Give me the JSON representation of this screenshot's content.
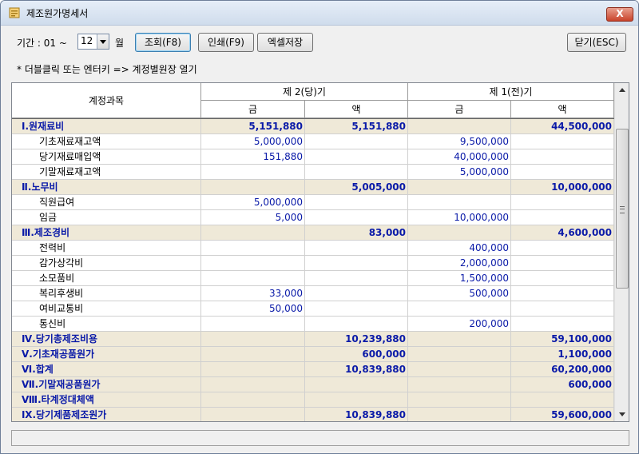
{
  "window": {
    "title": "제조원가명세서",
    "close_label": "X"
  },
  "toolbar": {
    "period_label": "기간 : 01 ~",
    "month_value": "12",
    "month_suffix": "월",
    "query_button": "조회(F8)",
    "print_button": "인쇄(F9)",
    "excel_button": "엑셀저장",
    "close_button": "닫기(ESC)"
  },
  "hint": "* 더블클릭 또는 엔터키 => 계정별원장 열기",
  "table": {
    "header_account": "계정과목",
    "period2": "제 2(당)기",
    "period1": "제 1(전)기",
    "amount_label": "금",
    "amount_label2": "액",
    "rows": [
      {
        "level": 0,
        "name": "Ⅰ.원재료비",
        "c1": "5,151,880",
        "c2": "5,151,880",
        "c3": "",
        "c4": "44,500,000"
      },
      {
        "level": 1,
        "name": "기초재료재고액",
        "c1": "5,000,000",
        "c2": "",
        "c3": "9,500,000",
        "c4": ""
      },
      {
        "level": 1,
        "name": "당기재료매입액",
        "c1": "151,880",
        "c2": "",
        "c3": "40,000,000",
        "c4": ""
      },
      {
        "level": 1,
        "name": "기말재료재고액",
        "c1": "",
        "c2": "",
        "c3": "5,000,000",
        "c4": ""
      },
      {
        "level": 0,
        "name": "Ⅱ.노무비",
        "c1": "",
        "c2": "5,005,000",
        "c3": "",
        "c4": "10,000,000"
      },
      {
        "level": 1,
        "name": "직원급여",
        "c1": "5,000,000",
        "c2": "",
        "c3": "",
        "c4": ""
      },
      {
        "level": 1,
        "name": "임금",
        "c1": "5,000",
        "c2": "",
        "c3": "10,000,000",
        "c4": ""
      },
      {
        "level": 0,
        "name": "Ⅲ.제조경비",
        "c1": "",
        "c2": "83,000",
        "c3": "",
        "c4": "4,600,000"
      },
      {
        "level": 1,
        "name": "전력비",
        "c1": "",
        "c2": "",
        "c3": "400,000",
        "c4": ""
      },
      {
        "level": 1,
        "name": "감가상각비",
        "c1": "",
        "c2": "",
        "c3": "2,000,000",
        "c4": ""
      },
      {
        "level": 1,
        "name": "소모품비",
        "c1": "",
        "c2": "",
        "c3": "1,500,000",
        "c4": ""
      },
      {
        "level": 1,
        "name": "복리후생비",
        "c1": "33,000",
        "c2": "",
        "c3": "500,000",
        "c4": ""
      },
      {
        "level": 1,
        "name": "여비교통비",
        "c1": "50,000",
        "c2": "",
        "c3": "",
        "c4": ""
      },
      {
        "level": 1,
        "name": "통신비",
        "c1": "",
        "c2": "",
        "c3": "200,000",
        "c4": ""
      },
      {
        "level": 0,
        "name": "Ⅳ.당기총제조비용",
        "c1": "",
        "c2": "10,239,880",
        "c3": "",
        "c4": "59,100,000"
      },
      {
        "level": 0,
        "name": "Ⅴ.기초재공품원가",
        "c1": "",
        "c2": "600,000",
        "c3": "",
        "c4": "1,100,000"
      },
      {
        "level": 0,
        "name": "Ⅵ.합계",
        "c1": "",
        "c2": "10,839,880",
        "c3": "",
        "c4": "60,200,000"
      },
      {
        "level": 0,
        "name": "Ⅶ.기말재공품원가",
        "c1": "",
        "c2": "",
        "c3": "",
        "c4": "600,000"
      },
      {
        "level": 0,
        "name": "Ⅷ.타계정대체액",
        "c1": "",
        "c2": "",
        "c3": "",
        "c4": ""
      },
      {
        "level": 0,
        "name": "Ⅸ.당기제품제조원가",
        "c1": "",
        "c2": "10,839,880",
        "c3": "",
        "c4": "59,600,000"
      }
    ]
  }
}
